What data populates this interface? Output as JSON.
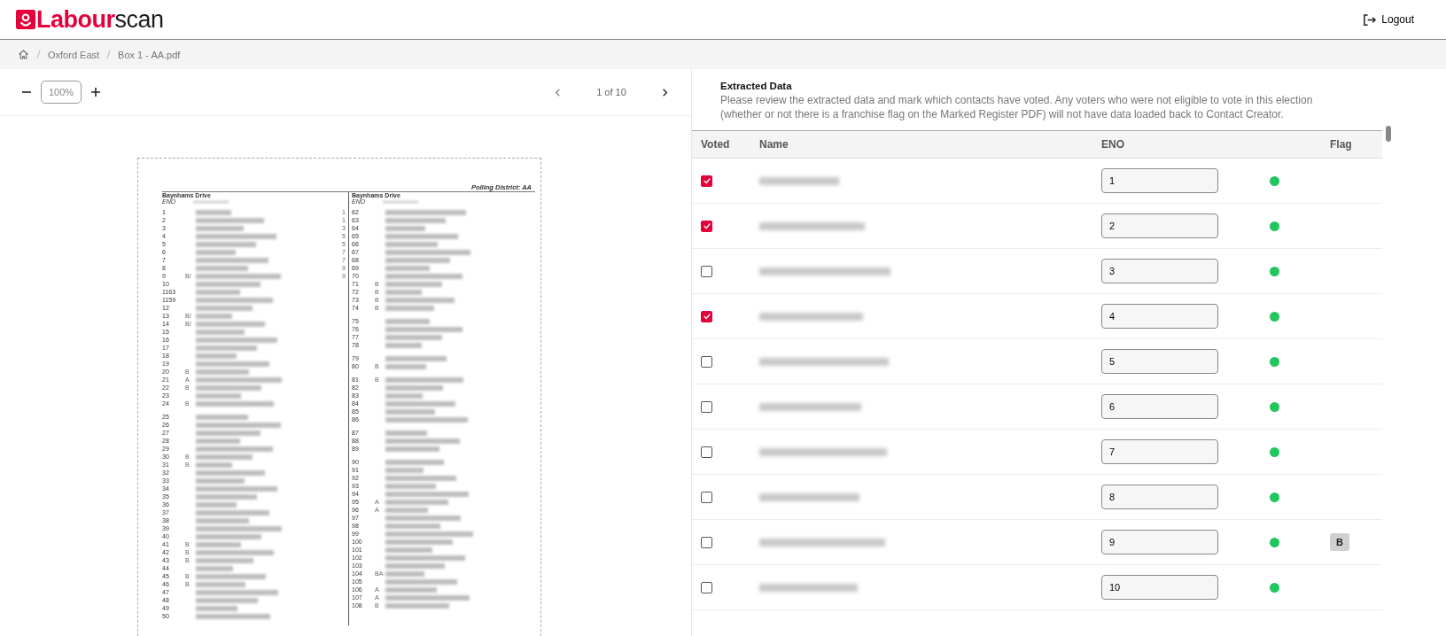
{
  "app": {
    "logo": "**Labour**scan",
    "logout": "Logout"
  },
  "breadcrumb": [
    "Oxford East",
    "Box 1 - AA.pdf"
  ],
  "viewer": {
    "zoom": "100%",
    "page": "1 of 10",
    "document": {
      "district": "Polling District: AA",
      "columns": [
        {
          "street": "Baynhams Drive",
          "eno_heading": "ENO",
          "blocks": [
            {
              "rows": [
                {
                  "eno": "1",
                  "house": "1"
                },
                {
                  "eno": "2",
                  "house": "1"
                },
                {
                  "eno": "3",
                  "house": "3"
                },
                {
                  "eno": "4",
                  "house": "5"
                },
                {
                  "eno": "5",
                  "house": "5"
                },
                {
                  "eno": "6",
                  "house": "7"
                },
                {
                  "eno": "7",
                  "house": "7"
                },
                {
                  "eno": "8",
                  "house": "9"
                },
                {
                  "eno": "9",
                  "mark": "B/",
                  "house": "9"
                },
                {
                  "eno": "10"
                },
                {
                  "eno": "1163"
                },
                {
                  "eno": "1159"
                },
                {
                  "eno": "12"
                },
                {
                  "eno": "13",
                  "mark": "B/"
                },
                {
                  "eno": "14",
                  "mark": "B/"
                },
                {
                  "eno": "15"
                },
                {
                  "eno": "16"
                },
                {
                  "eno": "17"
                },
                {
                  "eno": "18"
                },
                {
                  "eno": "19"
                },
                {
                  "eno": "20",
                  "mark": "B"
                },
                {
                  "eno": "21",
                  "mark": "A"
                },
                {
                  "eno": "22",
                  "mark": "B"
                },
                {
                  "eno": "23"
                },
                {
                  "eno": "24",
                  "mark": "B"
                }
              ]
            },
            {
              "rows": [
                {
                  "eno": "25"
                },
                {
                  "eno": "26"
                },
                {
                  "eno": "27"
                },
                {
                  "eno": "28"
                },
                {
                  "eno": "29"
                },
                {
                  "eno": "30",
                  "mark": "B"
                },
                {
                  "eno": "31",
                  "mark": "B"
                },
                {
                  "eno": "32"
                },
                {
                  "eno": "33"
                },
                {
                  "eno": "34"
                },
                {
                  "eno": "35"
                },
                {
                  "eno": "36"
                },
                {
                  "eno": "37"
                },
                {
                  "eno": "38"
                },
                {
                  "eno": "39"
                },
                {
                  "eno": "40"
                },
                {
                  "eno": "41",
                  "mark": "B"
                },
                {
                  "eno": "42",
                  "mark": "B"
                },
                {
                  "eno": "43",
                  "mark": "B"
                },
                {
                  "eno": "44"
                },
                {
                  "eno": "45",
                  "mark": "B"
                },
                {
                  "eno": "46",
                  "mark": "B"
                },
                {
                  "eno": "47"
                },
                {
                  "eno": "48"
                },
                {
                  "eno": "49"
                },
                {
                  "eno": "50"
                }
              ]
            }
          ]
        },
        {
          "street": "Baynhams Drive",
          "eno_heading": "ENO",
          "blocks": [
            {
              "rows": [
                {
                  "eno": "62"
                },
                {
                  "eno": "63"
                },
                {
                  "eno": "64"
                },
                {
                  "eno": "65"
                },
                {
                  "eno": "66"
                },
                {
                  "eno": "67"
                },
                {
                  "eno": "68"
                },
                {
                  "eno": "69"
                },
                {
                  "eno": "70"
                },
                {
                  "eno": "71",
                  "mark": "B"
                },
                {
                  "eno": "72",
                  "mark": "B"
                },
                {
                  "eno": "73",
                  "mark": "B"
                },
                {
                  "eno": "74",
                  "mark": "B"
                }
              ]
            },
            {
              "rows": [
                {
                  "eno": "75"
                },
                {
                  "eno": "76"
                },
                {
                  "eno": "77"
                },
                {
                  "eno": "78"
                }
              ]
            },
            {
              "rows": [
                {
                  "eno": "79"
                },
                {
                  "eno": "80",
                  "mark": "B"
                }
              ]
            },
            {
              "rows": [
                {
                  "eno": "81",
                  "mark": "B"
                },
                {
                  "eno": "82"
                },
                {
                  "eno": "83"
                },
                {
                  "eno": "84"
                },
                {
                  "eno": "85"
                },
                {
                  "eno": "86"
                }
              ]
            },
            {
              "rows": [
                {
                  "eno": "87"
                },
                {
                  "eno": "88"
                },
                {
                  "eno": "89"
                }
              ]
            },
            {
              "rows": [
                {
                  "eno": "90"
                },
                {
                  "eno": "91"
                },
                {
                  "eno": "92"
                },
                {
                  "eno": "93"
                },
                {
                  "eno": "94"
                },
                {
                  "eno": "95",
                  "mark": "A"
                },
                {
                  "eno": "96",
                  "mark": "A"
                },
                {
                  "eno": "97"
                },
                {
                  "eno": "98"
                },
                {
                  "eno": "99"
                },
                {
                  "eno": "100"
                },
                {
                  "eno": "101"
                },
                {
                  "eno": "102"
                },
                {
                  "eno": "103"
                },
                {
                  "eno": "104",
                  "mark": "BA"
                },
                {
                  "eno": "105"
                },
                {
                  "eno": "106",
                  "mark": "A"
                },
                {
                  "eno": "107",
                  "mark": "A"
                },
                {
                  "eno": "108",
                  "mark": "B"
                }
              ]
            }
          ]
        }
      ]
    }
  },
  "extracted": {
    "title": "Extracted Data",
    "description": "Please review the extracted data and mark which contacts have voted. Any voters who were not eligible to vote in this election (whether or not there is a franchise flag on the Marked Register PDF) will not have data loaded back to Contact Creator.",
    "columns": [
      "Voted",
      "Name",
      "ENO",
      "Flag"
    ],
    "rows": [
      {
        "voted": true,
        "eno": "1",
        "color": "#22c55e"
      },
      {
        "voted": true,
        "eno": "2",
        "color": "#22c55e"
      },
      {
        "voted": false,
        "eno": "3",
        "color": "#22c55e"
      },
      {
        "voted": true,
        "eno": "4",
        "color": "#22c55e"
      },
      {
        "voted": false,
        "eno": "5",
        "color": "#22c55e"
      },
      {
        "voted": false,
        "eno": "6",
        "color": "#22c55e"
      },
      {
        "voted": false,
        "eno": "7",
        "color": "#22c55e"
      },
      {
        "voted": false,
        "eno": "8",
        "color": "#22c55e"
      },
      {
        "voted": false,
        "eno": "9",
        "color": "#22c55e",
        "flag": "B"
      },
      {
        "voted": false,
        "eno": "10",
        "color": "#22c55e"
      }
    ]
  }
}
